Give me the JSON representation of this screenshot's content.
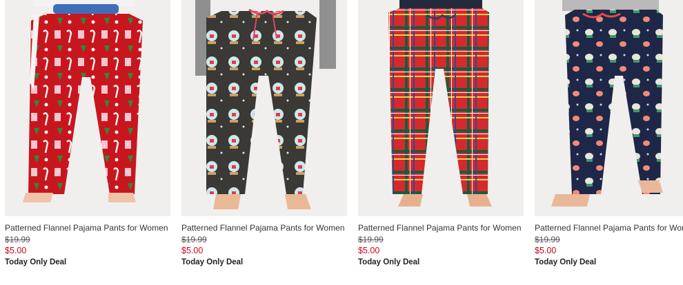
{
  "products": [
    {
      "name": "Patterned Flannel Pajama Pants for Women",
      "was_price": "$19.99",
      "sale_price": "$5.00",
      "deal": "Today Only Deal",
      "pattern": "candy-cane-red",
      "pant_color": "#c8161f"
    },
    {
      "name": "Patterned Flannel Pajama Pants for Women",
      "was_price": "$19.99",
      "sale_price": "$5.00",
      "deal": "Today Only Deal",
      "pattern": "snow-globe-charcoal",
      "pant_color": "#3a3935"
    },
    {
      "name": "Patterned Flannel Pajama Pants for Women",
      "was_price": "$19.99",
      "sale_price": "$5.00",
      "deal": "Today Only Deal",
      "pattern": "tartan-plaid-red",
      "pant_color": "#d42a2e"
    },
    {
      "name": "Patterned Flannel Pajama Pants for Women",
      "was_price": "$19.99",
      "sale_price": "$5.00",
      "deal": "Today Only Deal",
      "pattern": "animal-print-navy",
      "pant_color": "#1e2747"
    }
  ],
  "colors": {
    "sale_red": "#d0021b",
    "text": "#333333"
  }
}
